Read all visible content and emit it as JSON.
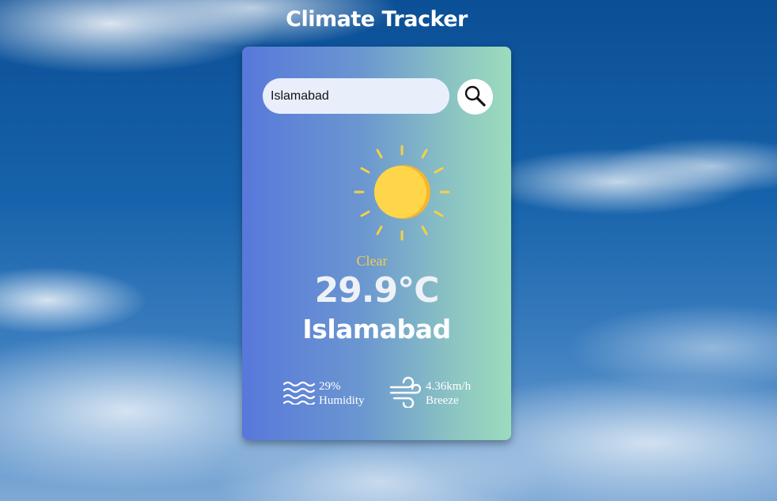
{
  "app": {
    "title": "Climate Tracker"
  },
  "search": {
    "value": "Islamabad",
    "button_icon": "search-icon"
  },
  "weather": {
    "icon": "sun-icon",
    "condition": "Clear",
    "temperature": "29.9°C",
    "city": "Islamabad"
  },
  "stats": {
    "humidity": {
      "icon": "waves-icon",
      "value": "29%",
      "label": "Humidity"
    },
    "wind": {
      "icon": "wind-icon",
      "value": "4.36km/h",
      "label": "Breeze"
    }
  },
  "colors": {
    "card_gradient_start": "#5878db",
    "card_gradient_end": "#9cdcbd",
    "sun": "#ffd54a",
    "sun_shade": "#f5b72c",
    "condition_text": "#f2cd4f",
    "search_field": "#e8effb"
  }
}
